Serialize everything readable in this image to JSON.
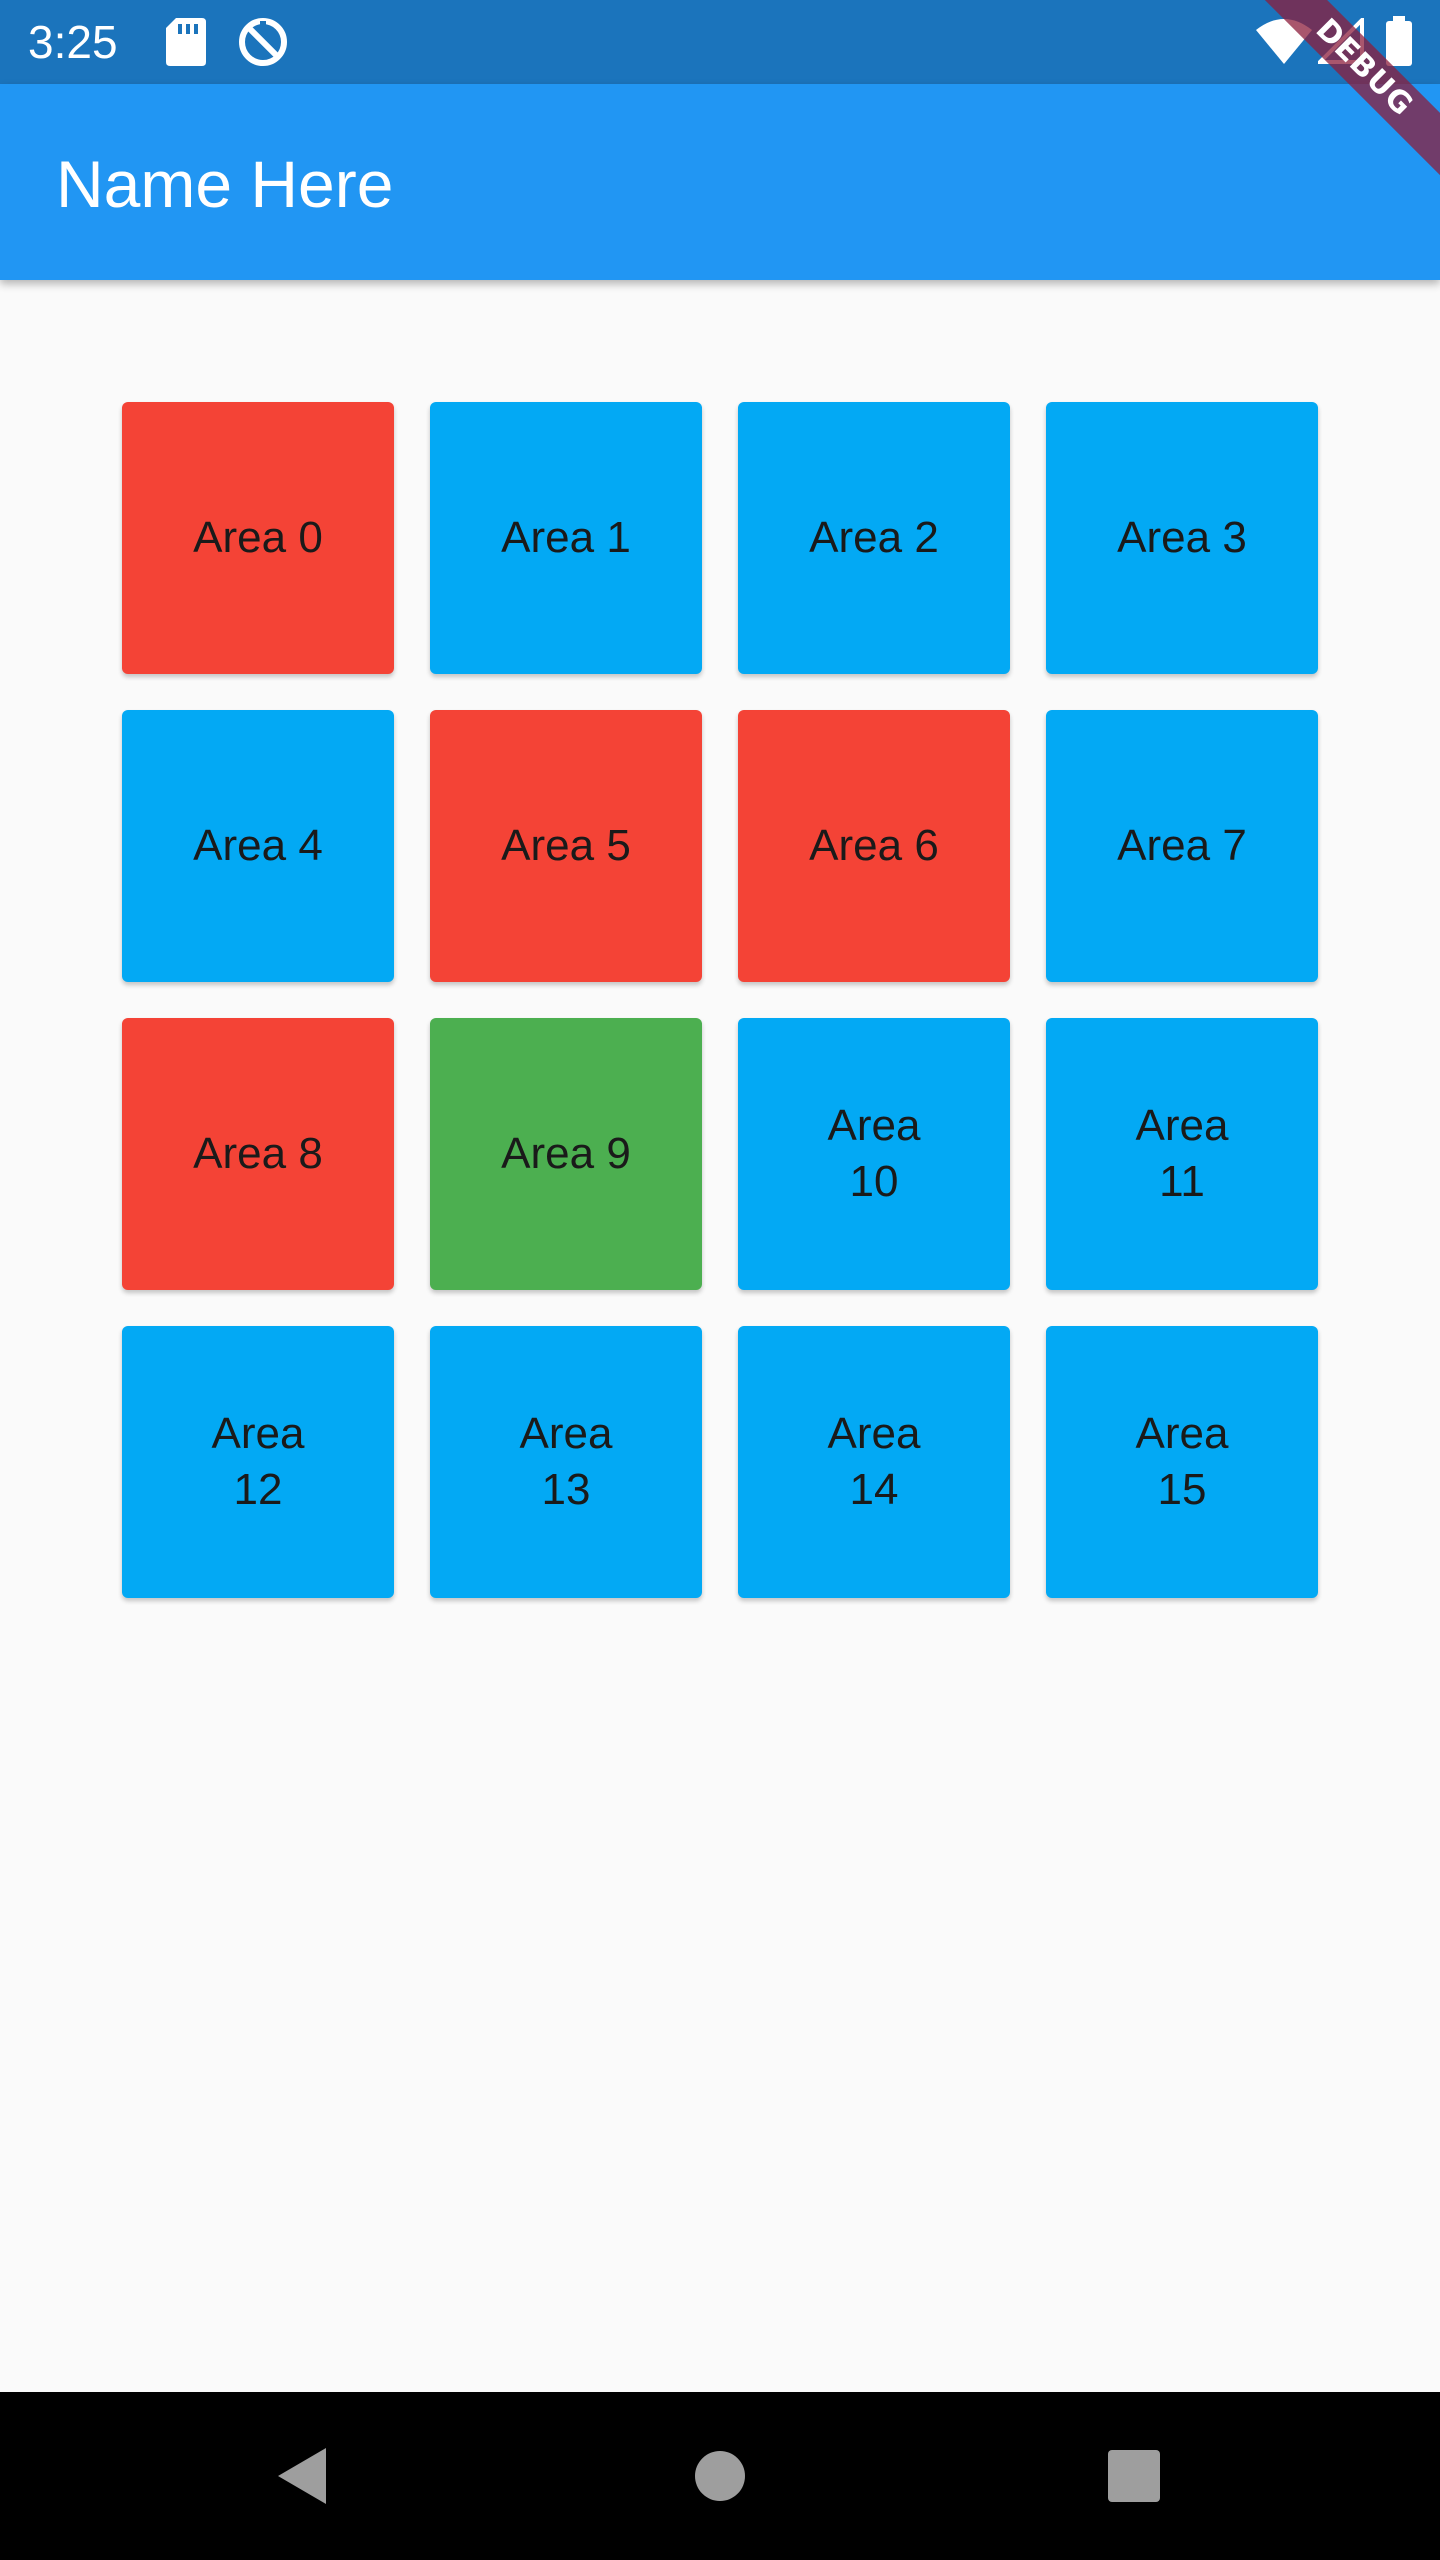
{
  "status_bar": {
    "time": "3:25",
    "icons": [
      "sd-card-icon",
      "data-saver-icon",
      "wifi-icon",
      "cellular-signal-icon",
      "battery-icon"
    ],
    "color": "#1b74bc"
  },
  "debug_banner": {
    "label": "DEBUG"
  },
  "app_bar": {
    "title": "Name Here",
    "color": "#2196f3"
  },
  "grid": {
    "colors": {
      "red": "#f44336",
      "blue": "#03a9f4",
      "green": "#4caf50"
    },
    "tiles": [
      {
        "label": "Area 0",
        "color": "#f44336"
      },
      {
        "label": "Area 1",
        "color": "#03a9f4"
      },
      {
        "label": "Area 2",
        "color": "#03a9f4"
      },
      {
        "label": "Area 3",
        "color": "#03a9f4"
      },
      {
        "label": "Area 4",
        "color": "#03a9f4"
      },
      {
        "label": "Area 5",
        "color": "#f44336"
      },
      {
        "label": "Area 6",
        "color": "#f44336"
      },
      {
        "label": "Area 7",
        "color": "#03a9f4"
      },
      {
        "label": "Area 8",
        "color": "#f44336"
      },
      {
        "label": "Area 9",
        "color": "#4caf50"
      },
      {
        "label": "Area 10",
        "color": "#03a9f4"
      },
      {
        "label": "Area 11",
        "color": "#03a9f4"
      },
      {
        "label": "Area 12",
        "color": "#03a9f4"
      },
      {
        "label": "Area 13",
        "color": "#03a9f4"
      },
      {
        "label": "Area 14",
        "color": "#03a9f4"
      },
      {
        "label": "Area 15",
        "color": "#03a9f4"
      }
    ]
  },
  "nav_bar": {
    "buttons": [
      "back-icon",
      "home-icon",
      "recents-icon"
    ]
  }
}
